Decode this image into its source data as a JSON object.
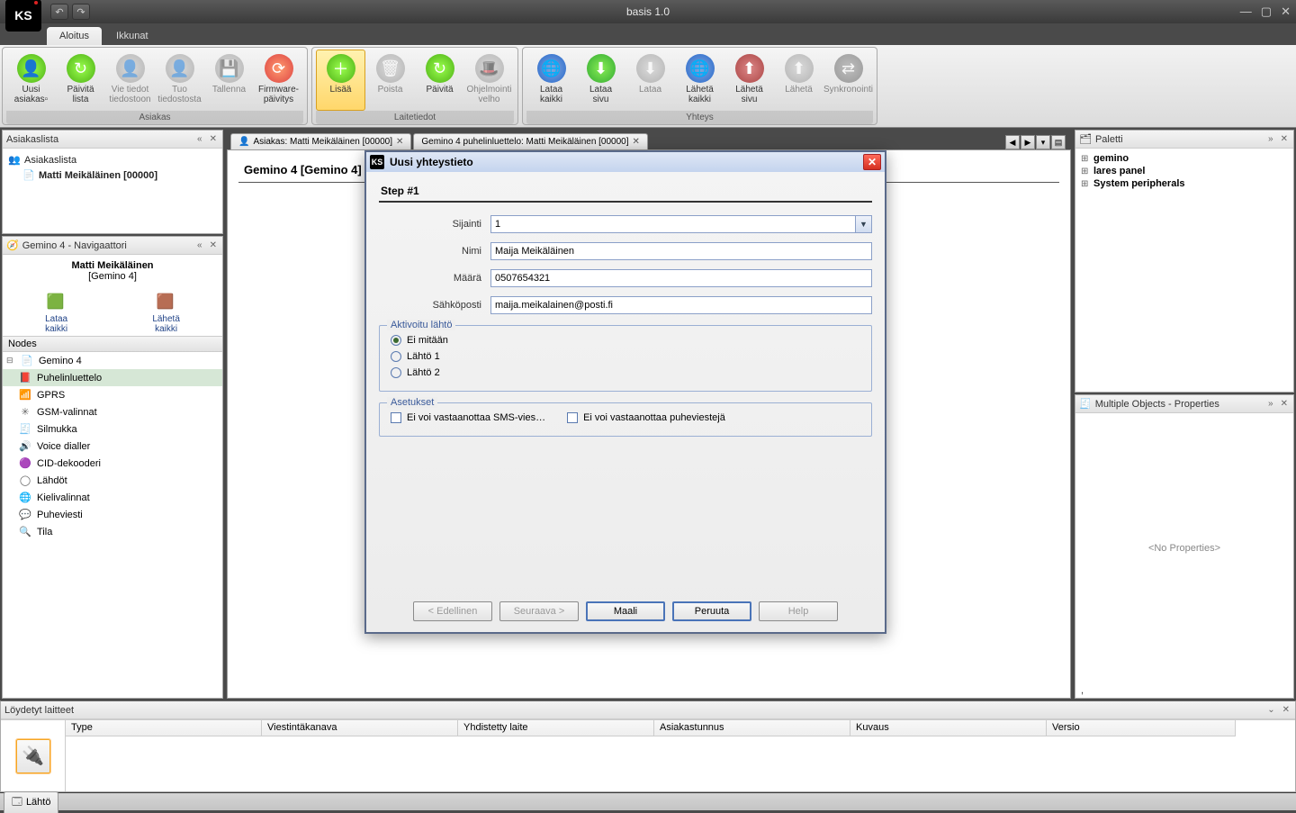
{
  "window": {
    "title": "basis 1.0"
  },
  "tabs": {
    "main": [
      "Aloitus",
      "Ikkunat"
    ],
    "active": 0
  },
  "ribbon": {
    "groups": [
      {
        "title": "Asiakas",
        "items": [
          {
            "label1": "Uusi",
            "label2": "asiakas▫",
            "ico": "ico-green",
            "glyph": "👤"
          },
          {
            "label1": "Päivitä",
            "label2": "lista",
            "ico": "ico-green",
            "glyph": "↻"
          },
          {
            "label1": "Vie tiedot",
            "label2": "tiedostoon",
            "ico": "ico-grey",
            "glyph": "👤",
            "disabled": true
          },
          {
            "label1": "Tuo",
            "label2": "tiedostosta",
            "ico": "ico-grey",
            "glyph": "👤",
            "disabled": true
          },
          {
            "label1": "Tallenna",
            "label2": "",
            "ico": "ico-grey",
            "glyph": "💾",
            "disabled": true
          },
          {
            "label1": "Firmware-",
            "label2": "päivitys",
            "ico": "ico-red",
            "glyph": "⟳"
          }
        ]
      },
      {
        "title": "Laitetiedot",
        "items": [
          {
            "label1": "Lisää",
            "label2": "",
            "ico": "ico-green",
            "glyph": "＋",
            "active": true
          },
          {
            "label1": "Poista",
            "label2": "",
            "ico": "ico-grey",
            "glyph": "🗑",
            "disabled": true
          },
          {
            "label1": "Päivitä",
            "label2": "",
            "ico": "ico-green",
            "glyph": "↻"
          },
          {
            "label1": "Ohjelmointi",
            "label2": "velho",
            "ico": "ico-grey",
            "glyph": "🎩",
            "disabled": true
          }
        ]
      },
      {
        "title": "Yhteys",
        "items": [
          {
            "label1": "Lataa",
            "label2": "kaikki",
            "ico": "ico-earth",
            "glyph": "🌐"
          },
          {
            "label1": "Lataa",
            "label2": "sivu",
            "ico": "ico-ygreen",
            "glyph": "⬇"
          },
          {
            "label1": "Lataa",
            "label2": "",
            "ico": "ico-grey",
            "glyph": "⬇",
            "disabled": true
          },
          {
            "label1": "Lähetä",
            "label2": "kaikki",
            "ico": "ico-earth",
            "glyph": "🌐"
          },
          {
            "label1": "Lähetä",
            "label2": "sivu",
            "ico": "ico-book",
            "glyph": "⬆"
          },
          {
            "label1": "Lähetä",
            "label2": "",
            "ico": "ico-grey",
            "glyph": "⬆",
            "disabled": true
          },
          {
            "label1": "Synkronointi",
            "label2": "",
            "ico": "ico-dark",
            "glyph": "⇄",
            "disabled": true
          }
        ]
      }
    ]
  },
  "asiakaslista": {
    "title": "Asiakaslista",
    "root": "Asiakaslista",
    "item": "Matti Meikäläinen [00000]"
  },
  "nav": {
    "title": "Gemino 4 - Navigaattori",
    "name": "Matti Meikäläinen",
    "sub": "[Gemino 4]",
    "btn1": "Lataa\nkaikki",
    "btn2": "Lähetä\nkaikki",
    "nodes_label": "Nodes",
    "nodes": [
      {
        "label": "Gemino 4",
        "glyph": "📄",
        "root": true
      },
      {
        "label": "Puhelinluettelo",
        "glyph": "📕",
        "selected": true
      },
      {
        "label": "GPRS",
        "glyph": "📶"
      },
      {
        "label": "GSM-valinnat",
        "glyph": "✳"
      },
      {
        "label": "Silmukka",
        "glyph": "🧾"
      },
      {
        "label": "Voice dialler",
        "glyph": "🔊"
      },
      {
        "label": "CID-dekooderi",
        "glyph": "🟣"
      },
      {
        "label": "Lähdöt",
        "glyph": "◯"
      },
      {
        "label": "Kielivalinnat",
        "glyph": "🌐"
      },
      {
        "label": "Puheviesti",
        "glyph": "💬"
      },
      {
        "label": "Tila",
        "glyph": "🔍"
      }
    ]
  },
  "doc_tabs": {
    "t0": "Asiakas: Matti Meikäläinen [00000]",
    "t1": "Gemino 4 puhelinluettelo: Matti Meikäläinen [00000]"
  },
  "doc_title": "Gemino 4 [Gemino 4] p",
  "palette": {
    "title": "Paletti",
    "items": [
      "gemino",
      "lares panel",
      "System peripherals"
    ]
  },
  "props": {
    "title": "Multiple Objects - Properties",
    "empty": "<No Properties>",
    "comma": ","
  },
  "found": {
    "title": "Löydetyt laitteet",
    "cols": [
      "Type",
      "Viestintäkanava",
      "Yhdistetty laite",
      "Asiakastunnus",
      "Kuvaus",
      "Versio"
    ]
  },
  "bottom_tab": "Lähtö",
  "modal": {
    "title": "Uusi yhteystieto",
    "step": "Step #1",
    "f_sijainti": "Sijainti",
    "v_sijainti": "1",
    "f_nimi": "Nimi",
    "v_nimi": "Maija Meikäläinen",
    "f_maara": "Määrä",
    "v_maara": "0507654321",
    "f_email": "Sähköposti",
    "v_email": "maija.meikalainen@posti.fi",
    "grp_akt": "Aktivoitu lähtö",
    "r_none": "Ei mitään",
    "r_1": "Lähtö 1",
    "r_2": "Lähtö 2",
    "grp_set": "Asetukset",
    "c_sms": "Ei voi vastaanottaa SMS-vies…",
    "c_voice": "Ei voi vastaanottaa puheviestejä",
    "btn_prev": "< Edellinen",
    "btn_next": "Seuraava >",
    "btn_finish": "Maali",
    "btn_cancel": "Peruuta",
    "btn_help": "Help"
  }
}
